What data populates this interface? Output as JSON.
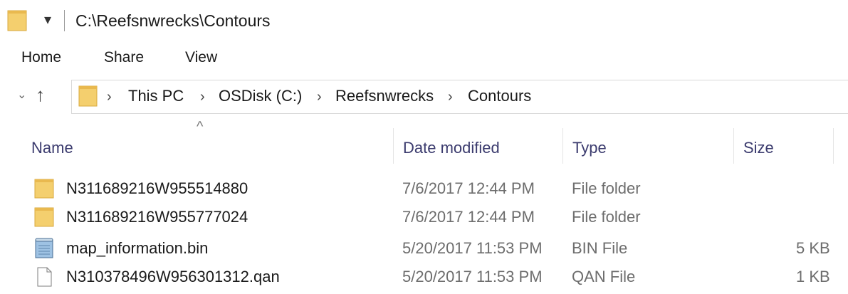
{
  "window": {
    "title": "C:\\Reefsnwrecks\\Contours",
    "quick_access_dropdown": "▾",
    "folder_icon": "folder-icon"
  },
  "ribbon": {
    "tabs": [
      "Home",
      "Share",
      "View"
    ]
  },
  "address_bar": {
    "breadcrumbs": [
      "This PC",
      "OSDisk (C:)",
      "Reefsnwrecks",
      "Contours"
    ],
    "separator": "›",
    "recent_locations": "⌄",
    "up": "↑"
  },
  "columns": {
    "name": "Name",
    "date_modified": "Date modified",
    "type": "Type",
    "size": "Size",
    "sort_indicator": "^"
  },
  "files": [
    {
      "name": "N311689216W955514880",
      "date": "7/6/2017 12:44 PM",
      "type": "File folder",
      "size": "",
      "icon": "folder-icon"
    },
    {
      "name": "N311689216W955777024",
      "date": "7/6/2017 12:44 PM",
      "type": "File folder",
      "size": "",
      "icon": "folder-icon"
    },
    {
      "name": "map_information.bin",
      "date": "5/20/2017 11:53 PM",
      "type": "BIN File",
      "size": "5 KB",
      "icon": "binary-file-icon"
    },
    {
      "name": "N310378496W956301312.qan",
      "date": "5/20/2017 11:53 PM",
      "type": "QAN File",
      "size": "1 KB",
      "icon": "file-icon"
    }
  ],
  "colors": {
    "folder": "#f4cf6e",
    "folder_edge": "#d9a93d",
    "header_text": "#3b3b6e",
    "muted_text": "#6d6d6d"
  }
}
